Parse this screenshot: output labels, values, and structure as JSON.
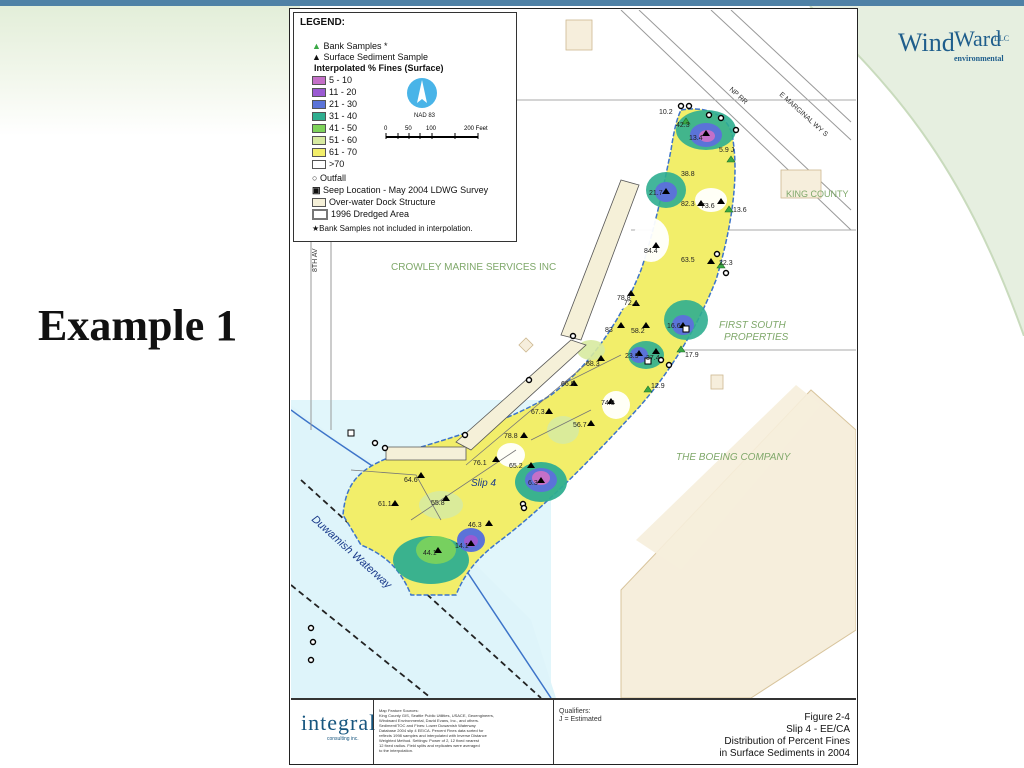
{
  "slide": {
    "title": "Example 1",
    "colors": {
      "top_bar": "#4f81a6",
      "green_wash": "#dde9d2"
    }
  },
  "logo": {
    "wind": "Wind",
    "ward": "Ward",
    "llc": "LLC",
    "sub": "environmental"
  },
  "map": {
    "legend": {
      "title": "LEGEND:",
      "bank_samples": "Bank Samples *",
      "surface_sediment": "Surface Sediment Sample",
      "interp_heading": "Interpolated % Fines (Surface)",
      "classes": [
        {
          "label": "5 - 10",
          "color": "#c470c8"
        },
        {
          "label": "11 - 20",
          "color": "#9a5ad2"
        },
        {
          "label": "21 - 30",
          "color": "#5b73d8"
        },
        {
          "label": "31 - 40",
          "color": "#2fae90"
        },
        {
          "label": "41 - 50",
          "color": "#7ed35a"
        },
        {
          "label": "51 - 60",
          "color": "#d7eaa0"
        },
        {
          "label": "61 - 70",
          "color": "#f2ee6a"
        },
        {
          "label": ">70",
          "color": "#ffffff"
        }
      ],
      "outfall": "Outfall",
      "seep": "Seep Location - May 2004 LDWG Survey",
      "overwater": "Over-water Dock Structure",
      "dredged": "1996 Dredged Area",
      "note": "Bank Samples not included in interpolation."
    },
    "north": {
      "label": "NAD 83"
    },
    "scale": {
      "ticks": [
        "0",
        "50",
        "100"
      ],
      "end": "200 Feet"
    },
    "labels": {
      "crowley": "CROWLEY MARINE SERVICES INC",
      "first_south_1": "FIRST SOUTH",
      "first_south_2": "PROPERTIES",
      "boeing": "THE BOEING COMPANY",
      "king_county": "KING COUNTY",
      "slip": "Slip 4",
      "waterway": "Duwamish Waterway",
      "npr": "NP RR",
      "marginal": "E MARGINAL WY S",
      "eighth_ave": "8TH AV"
    },
    "sample_values": [
      "10.2",
      "42.3",
      "13.4",
      "5.9 J",
      "38.8",
      "21.7",
      "82.3",
      "73.6",
      "13.6",
      "84.4",
      "63.5",
      "22.3",
      "78.8",
      "72.4",
      "83",
      "58.2",
      "16.6",
      "23.9",
      "37.4",
      "17.9",
      "12.9",
      "68.3",
      "66.9",
      "74.8",
      "67.3",
      "56.7",
      "78.8",
      "76.1",
      "65.2",
      "6.3",
      "64.6",
      "61.1",
      "55.8",
      "46.3",
      "44.1",
      "14.1"
    ]
  },
  "title_block": {
    "company": "integral",
    "company_sub": "consulting inc.",
    "fine_print": [
      "Map Feature Sources:",
      "King County GIS, Seattle Public Utilities, USACE, Geoengineers,",
      "Windward Environmental, David Evans, Inc., and others.",
      "Sediment/TOC and Fines: Lower Duwamish Waterway",
      "Database 2004 slip 4 EE/CA. Percent Fines data sorted for",
      "reflects 1998 samples and interpolated with Inverse Distance",
      "Weighted Method. Settings: Power of 2, 12 fixed nearest",
      "12 fixed radius. Field splits and replicates were averaged",
      "to the interpolation."
    ],
    "qualifiers": [
      "Qualifiers:",
      "J = Estimated"
    ],
    "figure_lines": [
      "Figure 2-4",
      "Slip 4 - EE/CA",
      "Distribution of Percent Fines",
      "in Surface Sediments in 2004"
    ]
  }
}
